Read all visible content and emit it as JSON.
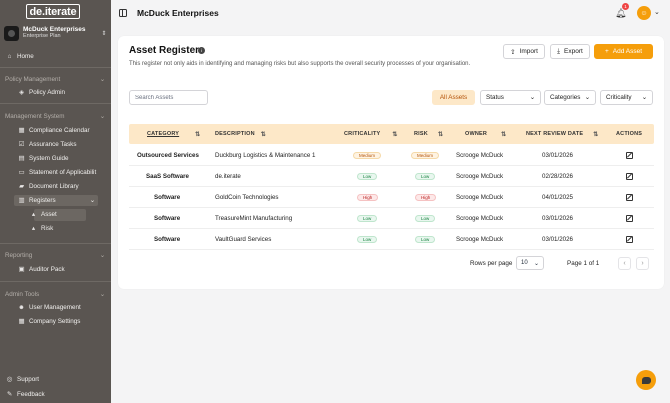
{
  "sidebar": {
    "logo": "de.iterate",
    "org_name": "McDuck Enterprises",
    "org_plan": "Enterprise Plan",
    "home": "Home",
    "sections": {
      "policy": "Policy Management",
      "management": "Management System",
      "reporting": "Reporting",
      "admin": "Admin Tools"
    },
    "items": {
      "policy_admin": "Policy Admin",
      "compliance_calendar": "Compliance Calendar",
      "assurance_tasks": "Assurance Tasks",
      "system_guide": "System Guide",
      "statement": "Statement of Applicabilit",
      "document_library": "Document Library",
      "registers": "Registers",
      "asset": "Asset",
      "risk": "Risk",
      "auditor_pack": "Auditor Pack",
      "user_management": "User Management",
      "company_settings": "Company Settings",
      "support": "Support",
      "feedback": "Feedback"
    }
  },
  "topbar": {
    "title": "McDuck Enterprises",
    "notification_count": "1"
  },
  "card": {
    "title": "Asset Register",
    "description": "This register not only aids in identifying and managing risks but also supports the overall security processes of your organisation.",
    "import_label": "Import",
    "export_label": "Export",
    "add_label": "Add Asset",
    "search_placeholder": "Search Assets",
    "filter_all": "All Assets",
    "filter_status": "Status",
    "filter_categories": "Categories",
    "filter_criticality": "Criticality"
  },
  "table": {
    "headers": {
      "category": "CATEGORY",
      "description": "DESCRIPTION",
      "criticality": "CRITICALITY",
      "risk": "RISK",
      "owner": "OWNER",
      "next_review": "NEXT REVIEW DATE",
      "actions": "ACTIONS"
    },
    "rows": [
      {
        "category": "Outsourced Services",
        "description": "Duckburg Logistics & Maintenance 1",
        "criticality": "Medium",
        "risk": "Medium",
        "owner": "Scrooge McDuck",
        "date": "03/01/2026"
      },
      {
        "category": "SaaS Software",
        "description": "de.iterate",
        "criticality": "Low",
        "risk": "Low",
        "owner": "Scrooge McDuck",
        "date": "02/28/2026"
      },
      {
        "category": "Software",
        "description": "GoldCoin Technologies",
        "criticality": "High",
        "risk": "High",
        "owner": "Scrooge McDuck",
        "date": "04/01/2025"
      },
      {
        "category": "Software",
        "description": "TreasureMint Manufacturing",
        "criticality": "Low",
        "risk": "Low",
        "owner": "Scrooge McDuck",
        "date": "03/01/2026"
      },
      {
        "category": "Software",
        "description": "VaultGuard Services",
        "criticality": "Low",
        "risk": "Low",
        "owner": "Scrooge McDuck",
        "date": "03/01/2026"
      }
    ]
  },
  "pagination": {
    "rows_per_page_label": "Rows per page",
    "rows_per_page": "10",
    "page_text": "Page 1 of 1"
  },
  "colors": {
    "accent": "#f59e0b",
    "sidebar": "#5a5551",
    "header_row": "#fde8c8"
  }
}
